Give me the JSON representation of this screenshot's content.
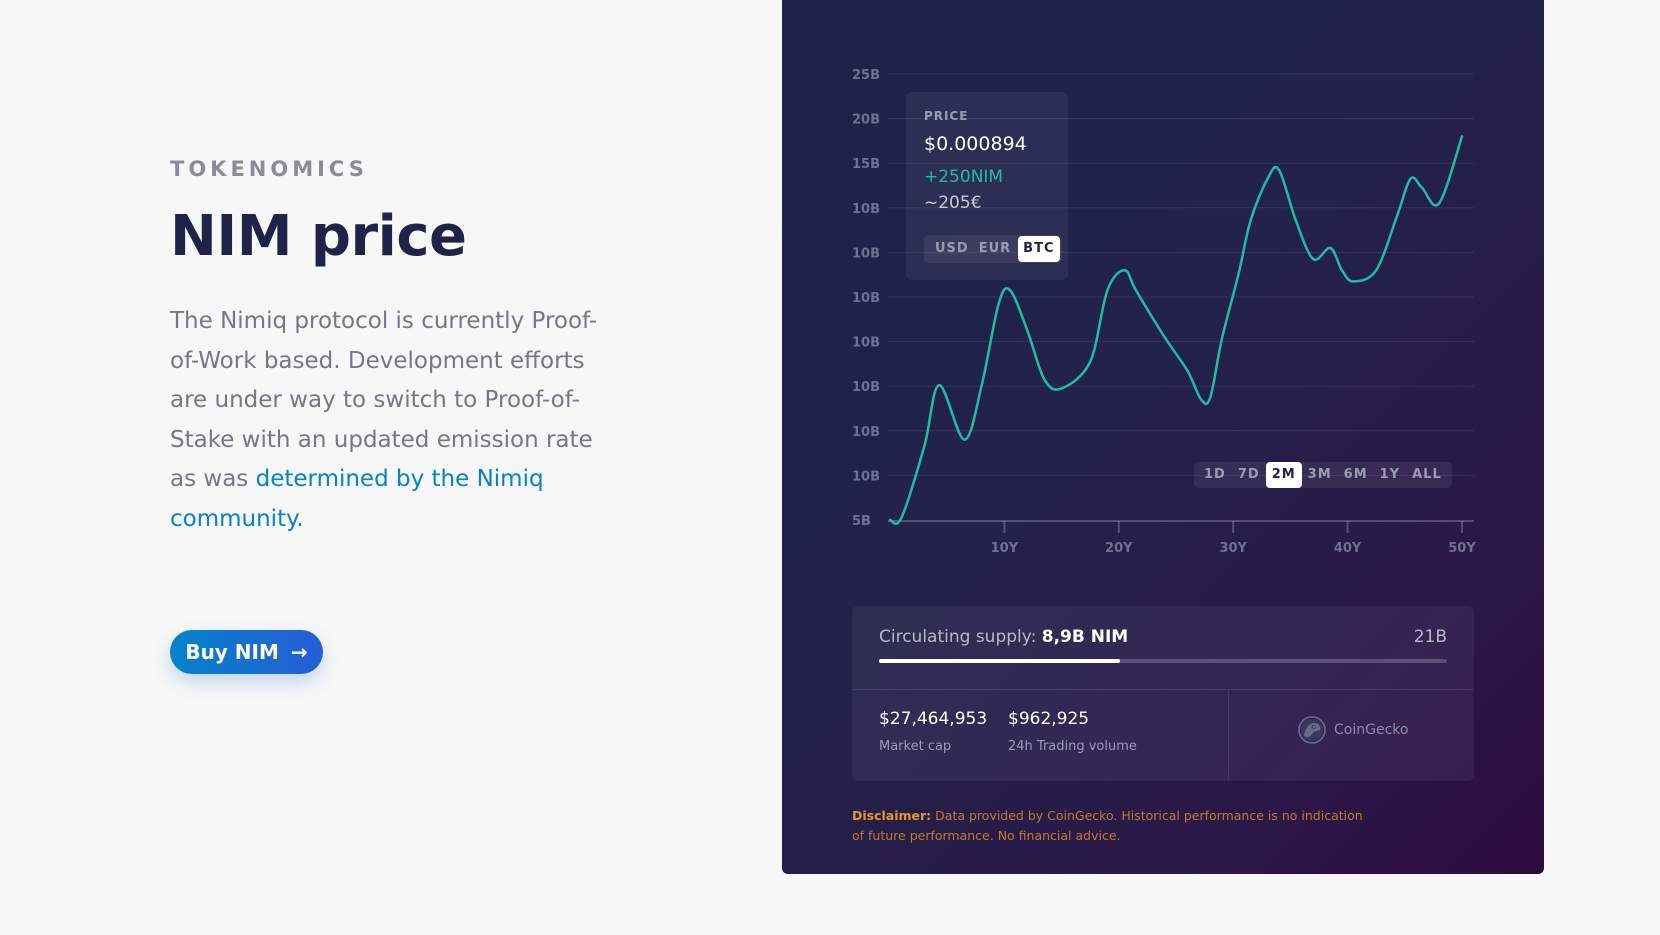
{
  "left": {
    "eyebrow": "TOKENOMICS",
    "headline": "NIM price",
    "body_text": "The Nimiq protocol is currently Proof-of-Work based. Development efforts are under way to switch to Proof-of-Stake with an updated emission rate as was",
    "body_link": "determined by the Nimiq community.",
    "buy_button_label": "Buy NIM",
    "buy_button_arrow": "→"
  },
  "tooltip": {
    "label": "PRICE",
    "price": "$0.000894",
    "nim_change": "+250NIM",
    "eur_value": "~205€",
    "currencies": [
      "USD",
      "EUR",
      "BTC"
    ],
    "active_currency": "BTC"
  },
  "ranges": {
    "options": [
      "1D",
      "7D",
      "2M",
      "3M",
      "6M",
      "1Y",
      "ALL"
    ],
    "active": "2M"
  },
  "chart_data": {
    "type": "line",
    "y_tick_labels": [
      "25B",
      "20B",
      "15B",
      "10B",
      "10B",
      "10B",
      "10B",
      "10B",
      "10B",
      "10B",
      "5B"
    ],
    "x_tick_labels": [
      "10Y",
      "20Y",
      "30Y",
      "40Y",
      "50Y"
    ],
    "xlim": [
      0,
      50
    ],
    "ylim": [
      5,
      25
    ],
    "line_color": "#21bca5",
    "series": [
      {
        "x": [
          0,
          1,
          3,
          4.3,
          6.5,
          8,
          9.5,
          10.5,
          12,
          13.5,
          15,
          17.5,
          19,
          20.5,
          21.5,
          24,
          26,
          27.2,
          28,
          29,
          30.5,
          31.5,
          33,
          34,
          35.5,
          37,
          38.5,
          39.5,
          40.5,
          42.5,
          44.3,
          45.5,
          46.5,
          48,
          50
        ],
        "y": [
          5,
          5.1,
          8.3,
          11.05,
          8.6,
          11,
          14.7,
          15.3,
          13.5,
          11.3,
          10.9,
          12.1,
          15.3,
          16.2,
          15.3,
          13.2,
          11.7,
          10.4,
          10.5,
          13.1,
          16.1,
          18.4,
          20.3,
          20.7,
          18.4,
          16.7,
          17.2,
          16.2,
          15.7,
          16.2,
          18.6,
          20.3,
          19.9,
          19.2,
          22.2
        ]
      }
    ]
  },
  "stats": {
    "supply_label": "Circulating supply:",
    "supply_value": "8,9B NIM",
    "supply_max": "21B",
    "supply_fraction": 0.424,
    "market_cap_value": "$27,464,953",
    "market_cap_label": "Market cap",
    "volume_value": "$962,925",
    "volume_label": "24h Trading volume",
    "provider": "CoinGecko"
  },
  "disclaimer": {
    "label": "Disclaimer:",
    "text": "Data provided by CoinGecko. Historical performance is no indication of future performance. No financial advice."
  },
  "colors": {
    "accent": "#0582ca",
    "panel_bg": "#1f2348",
    "line": "#21bca5",
    "disclaimer": "#e8972a"
  }
}
